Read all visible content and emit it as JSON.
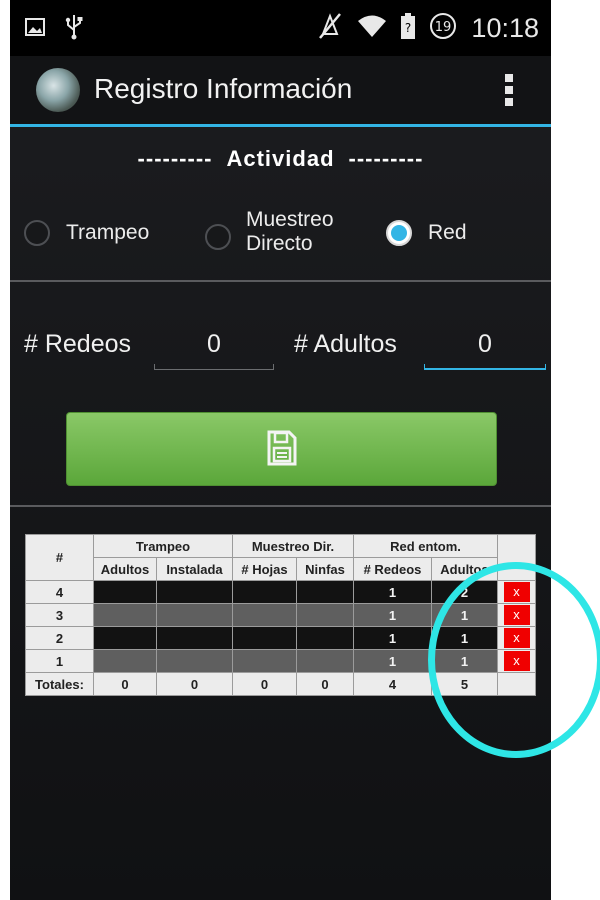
{
  "status_bar": {
    "time": "10:18",
    "notification_badge": "19",
    "icons": [
      "picture-icon",
      "usb-icon",
      "mute-icon",
      "wifi-icon",
      "battery-icon"
    ]
  },
  "action_bar": {
    "title": "Registro Información",
    "logo": "app-logo-icon",
    "overflow": "overflow-menu-icon"
  },
  "activity": {
    "dashes_left": "---------",
    "title": "Actividad",
    "dashes_right": "---------",
    "options": [
      {
        "label_line1": "Trampeo",
        "label_line2": "",
        "checked": false
      },
      {
        "label_line1": "Muestreo",
        "label_line2": "Directo",
        "checked": false
      },
      {
        "label_line1": "Red",
        "label_line2": "",
        "checked": true
      }
    ]
  },
  "counts": {
    "redeos_label": "# Redeos",
    "redeos_value": "0",
    "adultos_label": "# Adultos",
    "adultos_value": "0"
  },
  "save_button": {
    "icon": "save-icon",
    "color": "#6bb548"
  },
  "table": {
    "group_headers": {
      "num": "#",
      "trampeo": "Trampeo",
      "muestreo": "Muestreo Dir.",
      "red": "Red entom."
    },
    "sub_headers": [
      "Adultos",
      "Instalada",
      "# Hojas",
      "Ninfas",
      "# Redeos",
      "Adultos"
    ],
    "rows": [
      {
        "num": "4",
        "cells": [
          "",
          "",
          "",
          "",
          "1",
          "2"
        ],
        "delete": "x"
      },
      {
        "num": "3",
        "cells": [
          "",
          "",
          "",
          "",
          "1",
          "1"
        ],
        "delete": "x"
      },
      {
        "num": "2",
        "cells": [
          "",
          "",
          "",
          "",
          "1",
          "1"
        ],
        "delete": "x"
      },
      {
        "num": "1",
        "cells": [
          "",
          "",
          "",
          "",
          "1",
          "1"
        ],
        "delete": "x"
      }
    ],
    "totals": {
      "label": "Totales:",
      "values": [
        "0",
        "0",
        "0",
        "0",
        "4",
        "5"
      ]
    }
  },
  "colors": {
    "accent": "#33b5e5",
    "save_green": "#6bb548",
    "delete_red": "#f00000",
    "annotation_cyan": "#2ee6e6"
  }
}
